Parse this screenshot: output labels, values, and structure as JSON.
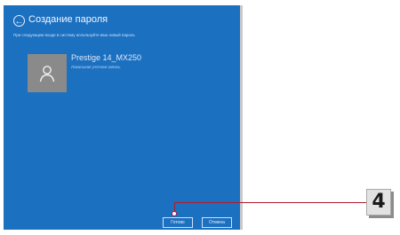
{
  "dialog": {
    "back_glyph": "←",
    "title": "Создание пароля",
    "subtitle": "При следующем входе в систему используйте ваш новый пароль"
  },
  "account": {
    "name": "Prestige 14_MX250",
    "type": "Локальная учетная запись",
    "avatar_icon": "user-icon"
  },
  "buttons": {
    "next_label": "Готово",
    "cancel_label": "Отмена"
  },
  "callout": {
    "step_number": "4",
    "color": "#b11a2a"
  },
  "colors": {
    "panel_bg": "#1c70c0",
    "avatar_bg": "#8a8a8a"
  }
}
